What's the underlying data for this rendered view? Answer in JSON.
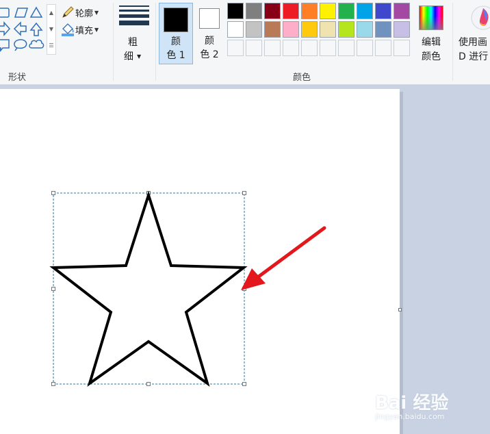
{
  "ribbon": {
    "shapes_group": {
      "label": "形状",
      "outline_label": "轮廓",
      "fill_label": "填充",
      "shapes": [
        "rectangle-icon",
        "parallelogram-icon",
        "triangle-icon",
        "arrow-right-icon",
        "arrow-left-icon",
        "arrow-up-icon",
        "callout-rect-icon",
        "callout-oval-icon",
        "callout-cloud-icon"
      ]
    },
    "size": {
      "label_top": "粗",
      "label_bottom": "细"
    },
    "colors_group": {
      "label": "颜色",
      "color1": {
        "line1": "颜",
        "line2": "色 1",
        "value": "#000000"
      },
      "color2": {
        "line1": "颜",
        "line2": "色 2",
        "value": "#ffffff"
      },
      "palette_row1": [
        "#000000",
        "#7f7f7f",
        "#880015",
        "#ed1c24",
        "#ff7f27",
        "#fff200",
        "#22b14c",
        "#00a2e8",
        "#3f48cc",
        "#a349a4"
      ],
      "palette_row2": [
        "#ffffff",
        "#c3c3c3",
        "#b97a57",
        "#ffaec9",
        "#ffc90e",
        "#efe4b0",
        "#b5e61d",
        "#99d9ea",
        "#7092be",
        "#c8bfe7"
      ],
      "edit_colors": {
        "line1": "编辑",
        "line2": "颜色"
      }
    },
    "paint3d": {
      "line1": "使用画",
      "line2": "D 进行"
    }
  },
  "watermark": {
    "text": "Bai 经验",
    "sub": "jingyan.baidu.com"
  },
  "accent_arrow_color": "#e3181c"
}
